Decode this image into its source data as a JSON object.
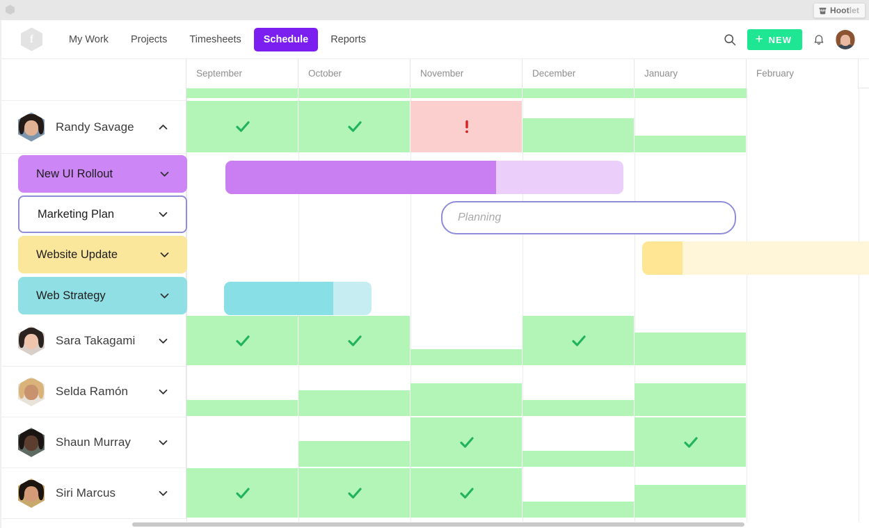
{
  "chrome": {
    "extension_badge": {
      "name": "Hoot",
      "name_suffix": "let",
      "icon": "owl-icon"
    }
  },
  "nav": {
    "logo_glyph": "f",
    "links": [
      {
        "label": "My Work",
        "active": false
      },
      {
        "label": "Projects",
        "active": false
      },
      {
        "label": "Timesheets",
        "active": false
      },
      {
        "label": "Schedule",
        "active": true
      },
      {
        "label": "Reports",
        "active": false
      }
    ],
    "search_icon": "search-icon",
    "new_button": {
      "label": "NEW",
      "plus": "+",
      "color": "#1ee693"
    },
    "bell_icon": "bell-icon",
    "avatar": "user-avatar"
  },
  "schedule": {
    "months": [
      "September",
      "October",
      "November",
      "December",
      "January",
      "February"
    ],
    "rows": [
      {
        "type": "person",
        "name": "Randy Savage",
        "expanded": true,
        "chevron": "chevron-up-icon",
        "avatar_colors": {
          "bg": "#7d95ad",
          "hair": "#241a16",
          "skin": "#e0b193"
        },
        "cells": [
          {
            "month": "September",
            "state": "available",
            "marker": "check"
          },
          {
            "month": "October",
            "state": "available",
            "marker": "check"
          },
          {
            "month": "November",
            "state": "overbooked",
            "marker": "alert"
          },
          {
            "month": "December",
            "state": "partial",
            "marker": "none"
          },
          {
            "month": "January",
            "state": "partial-low",
            "marker": "none"
          },
          {
            "month": "February",
            "state": "empty",
            "marker": "none"
          }
        ]
      },
      {
        "type": "project",
        "name": "New UI Rollout",
        "chevron": "chevron-down-icon",
        "pill_color": "#cd86f5",
        "bar": {
          "color": "#c97ef2",
          "rest_color": "#eccefb",
          "start_month": "September",
          "progress_pct": 68
        }
      },
      {
        "type": "project",
        "name": "Marketing Plan",
        "chevron": "chevron-down-icon",
        "pill_color": "#ffffff",
        "pill_border": "#8e8ed8",
        "selected": true,
        "bar": {
          "style": "outline",
          "placeholder": "Planning",
          "border_color": "#8e8ed8",
          "start_month": "November"
        }
      },
      {
        "type": "project",
        "name": "Website Update",
        "chevron": "chevron-down-icon",
        "pill_color": "#fbe79b",
        "bar": {
          "color": "#ffe695",
          "rest_color": "#fff6da",
          "start_month": "January",
          "progress_pct": 16
        }
      },
      {
        "type": "project",
        "name": "Web Strategy",
        "chevron": "chevron-down-icon",
        "pill_color": "#8fdfe4",
        "bar": {
          "color": "#89dfe6",
          "rest_color": "#c6eef2",
          "start_month": "September",
          "progress_pct": 74
        }
      },
      {
        "type": "person",
        "name": "Sara Takagami",
        "expanded": false,
        "chevron": "chevron-down-icon",
        "avatar_colors": {
          "bg": "#d8cfc8",
          "hair": "#2b2320",
          "skin": "#efc4ad"
        },
        "cells": [
          {
            "month": "September",
            "state": "available",
            "marker": "check"
          },
          {
            "month": "October",
            "state": "available",
            "marker": "check"
          },
          {
            "month": "November",
            "state": "partial-low",
            "marker": "none"
          },
          {
            "month": "December",
            "state": "available",
            "marker": "check"
          },
          {
            "month": "January",
            "state": "partial",
            "marker": "none"
          },
          {
            "month": "February",
            "state": "empty",
            "marker": "none"
          }
        ]
      },
      {
        "type": "person",
        "name": "Selda Ramón",
        "expanded": false,
        "chevron": "chevron-down-icon",
        "avatar_colors": {
          "bg": "#e8e2d8",
          "hair": "#d9b37a",
          "skin": "#c9926e"
        },
        "cells": [
          {
            "month": "September",
            "state": "partial-low",
            "marker": "none"
          },
          {
            "month": "October",
            "state": "partial-mid",
            "marker": "none"
          },
          {
            "month": "November",
            "state": "partial",
            "marker": "none"
          },
          {
            "month": "December",
            "state": "partial-low",
            "marker": "none"
          },
          {
            "month": "January",
            "state": "partial",
            "marker": "none"
          },
          {
            "month": "February",
            "state": "empty",
            "marker": "none"
          }
        ]
      },
      {
        "type": "person",
        "name": "Shaun Murray",
        "expanded": false,
        "chevron": "chevron-down-icon",
        "avatar_colors": {
          "bg": "#5f6b62",
          "hair": "#1a1512",
          "skin": "#5b3e2e"
        },
        "cells": [
          {
            "month": "September",
            "state": "empty",
            "marker": "none"
          },
          {
            "month": "October",
            "state": "partial-mid",
            "marker": "none"
          },
          {
            "month": "November",
            "state": "available",
            "marker": "check"
          },
          {
            "month": "December",
            "state": "partial-low",
            "marker": "none"
          },
          {
            "month": "January",
            "state": "available",
            "marker": "check"
          },
          {
            "month": "February",
            "state": "empty",
            "marker": "none"
          }
        ]
      },
      {
        "type": "person",
        "name": "Siri Marcus",
        "expanded": false,
        "chevron": "chevron-down-icon",
        "avatar_colors": {
          "bg": "#c9a86b",
          "hair": "#1c1410",
          "skin": "#d59b78"
        },
        "cells": [
          {
            "month": "September",
            "state": "available",
            "marker": "check"
          },
          {
            "month": "October",
            "state": "available",
            "marker": "check"
          },
          {
            "month": "November",
            "state": "available",
            "marker": "check"
          },
          {
            "month": "December",
            "state": "partial-low",
            "marker": "none"
          },
          {
            "month": "January",
            "state": "partial",
            "marker": "none"
          },
          {
            "month": "February",
            "state": "empty",
            "marker": "none"
          }
        ]
      }
    ],
    "legend_colors": {
      "available": "#b2f5b6",
      "overbooked": "#fccfcf",
      "check_mark": "#22b35e",
      "alert_mark": "#d92020"
    }
  }
}
